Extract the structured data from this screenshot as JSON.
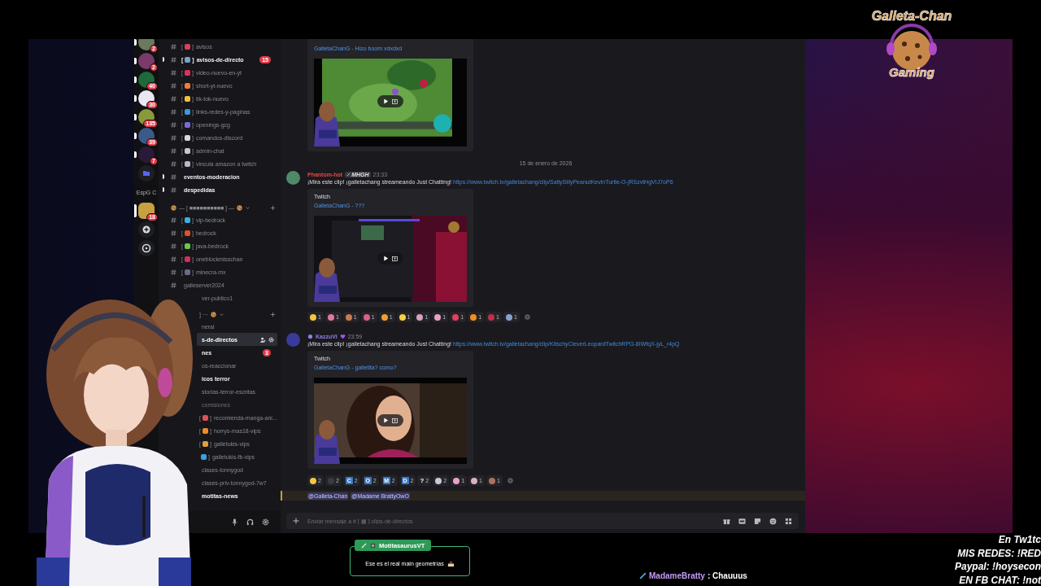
{
  "logo": {
    "title": "Galleta-Chan",
    "subtitle": "Gaming"
  },
  "servers": [
    {
      "kind": "server",
      "color": "#6b7a5a",
      "badge": "2",
      "unread": true,
      "selected": false
    },
    {
      "kind": "server",
      "color": "#7a3a6a",
      "badge": "2",
      "unread": true,
      "selected": false
    },
    {
      "kind": "server",
      "color": "#1f6a3a",
      "badge": "40",
      "unread": true,
      "selected": false
    },
    {
      "kind": "server",
      "color": "#e8e8f0",
      "badge": "30",
      "unread": true,
      "selected": false
    },
    {
      "kind": "server",
      "color": "#8a9a3a",
      "badge": "135",
      "unread": true,
      "selected": false
    },
    {
      "kind": "server",
      "color": "#3a5a8a",
      "badge": "39",
      "unread": true,
      "selected": false
    },
    {
      "kind": "server",
      "color": "#2a1a3a",
      "badge": "7",
      "unread": true,
      "selected": false
    },
    {
      "kind": "folder",
      "selected": false
    },
    {
      "kind": "label",
      "label": "EspG C",
      "selected": false
    },
    {
      "kind": "server",
      "color": "#c8a040",
      "badge": "18",
      "selected": true
    },
    {
      "kind": "add",
      "selected": false
    },
    {
      "kind": "discover",
      "selected": false
    }
  ],
  "channels": [
    {
      "kind": "channel",
      "open": "[",
      "color": "#d8405a",
      "close": "]",
      "name": "avisos",
      "unread": false,
      "selected": false,
      "muted": false
    },
    {
      "kind": "channel",
      "open": "[",
      "color": "#7aa0c8",
      "close": "]",
      "name": "avisos-de-directo",
      "unread": true,
      "selected": false,
      "muted": false,
      "badge": "15"
    },
    {
      "kind": "channel",
      "open": "[",
      "color": "#e0305a",
      "close": "]",
      "name": "video-nuevo-en-yt",
      "unread": false,
      "selected": false,
      "muted": false
    },
    {
      "kind": "channel",
      "open": "[",
      "color": "#f07a3a",
      "close": "]",
      "name": "short-yt-nuevo",
      "unread": false,
      "selected": false,
      "muted": false
    },
    {
      "kind": "channel",
      "open": "[",
      "color": "#f0c040",
      "close": "]",
      "name": "tik-tok-nuevo",
      "unread": false,
      "selected": false,
      "muted": false
    },
    {
      "kind": "channel",
      "open": "[",
      "color": "#3a9ad8",
      "close": "]",
      "name": "links-redes-y-paginas",
      "unread": false,
      "selected": false,
      "muted": false
    },
    {
      "kind": "channel",
      "open": "[",
      "color": "#7a6ad8",
      "close": "]",
      "name": "openings-gcg",
      "unread": false,
      "selected": false,
      "muted": false
    },
    {
      "kind": "channel",
      "open": "[",
      "color": "#d8d8e0",
      "close": "]",
      "name": "comandos-discord",
      "unread": false,
      "selected": false,
      "muted": false
    },
    {
      "kind": "channel",
      "open": "[",
      "color": "#c8c8d0",
      "close": "]",
      "name": "admin-chat",
      "unread": false,
      "selected": false,
      "muted": false
    },
    {
      "kind": "channel",
      "open": "[",
      "color": "#b8b8c8",
      "close": "]",
      "name": "vincula amazon a twitch",
      "unread": false,
      "selected": false,
      "muted": false
    },
    {
      "kind": "channel",
      "name": "eventos-moderacion",
      "unread": true,
      "selected": false,
      "muted": false
    },
    {
      "kind": "channel",
      "name": "despedidas",
      "unread": true,
      "selected": false,
      "muted": false
    },
    {
      "kind": "category",
      "name": "— [ ■■■■■■■■■■ ] —"
    },
    {
      "kind": "channel",
      "open": "[",
      "color": "#3ab0e0",
      "close": "]",
      "name": "vip-bedrock",
      "unread": false,
      "selected": false,
      "muted": false
    },
    {
      "kind": "channel",
      "open": "[",
      "color": "#e0502a",
      "close": "]",
      "name": "bedrock",
      "unread": false,
      "selected": false,
      "muted": false
    },
    {
      "kind": "channel",
      "open": "[",
      "color": "#6ac84a",
      "close": "]",
      "name": "java-bedrock",
      "unread": false,
      "selected": false,
      "muted": false
    },
    {
      "kind": "channel",
      "open": "[",
      "color": "#d0305a",
      "close": "]",
      "name": "oneblockmisschan",
      "unread": false,
      "selected": false,
      "muted": false
    },
    {
      "kind": "channel",
      "open": "[",
      "color": "#6a6a8a",
      "close": "]",
      "name": "minecra-mx",
      "unread": false,
      "selected": false,
      "muted": false
    },
    {
      "kind": "channel",
      "name": "galleserver2024",
      "unread": false,
      "selected": false,
      "muted": false
    },
    {
      "kind": "covered",
      "name": "ver-publico1",
      "unread": false,
      "selected": false,
      "muted": false
    },
    {
      "kind": "covered_category",
      "name": "] ···"
    },
    {
      "kind": "covered",
      "name": "neral",
      "unread": false,
      "selected": false,
      "muted": false
    },
    {
      "kind": "covered",
      "name": "s-de-directos",
      "unread": false,
      "selected": true,
      "muted": false
    },
    {
      "kind": "covered",
      "name": "nes",
      "unread": true,
      "selected": false,
      "muted": false,
      "badge": "3"
    },
    {
      "kind": "covered",
      "name": "os-reaccionar",
      "unread": false,
      "selected": false,
      "muted": false
    },
    {
      "kind": "covered",
      "name": "icos terror",
      "unread": true,
      "selected": false,
      "muted": false
    },
    {
      "kind": "covered",
      "name": "storias-terror-escritas",
      "unread": false,
      "selected": false,
      "muted": false
    },
    {
      "kind": "covered",
      "name": "comisiones",
      "unread": false,
      "selected": false,
      "muted": true
    },
    {
      "kind": "iconic",
      "open": "[",
      "color": "#e0505a",
      "close": "]",
      "name": "recomienda-manga-ani...",
      "unread": false,
      "selected": false,
      "muted": false
    },
    {
      "kind": "iconic",
      "open": "[",
      "color": "#f08a2a",
      "close": "]",
      "name": "horrys-mas18-vips",
      "unread": false,
      "selected": false,
      "muted": false
    },
    {
      "kind": "iconic",
      "open": "[",
      "color": "#e0a040",
      "close": "]",
      "name": "galletukis-vips",
      "unread": false,
      "selected": false,
      "muted": false
    },
    {
      "kind": "iconic",
      "color": "#3aa0e0",
      "close": "]",
      "name": "galletukis-fb-vips",
      "unread": false,
      "selected": false,
      "muted": false
    },
    {
      "kind": "covered",
      "name": "clases-tonnygod",
      "unread": false,
      "selected": false,
      "muted": false
    },
    {
      "kind": "covered",
      "name": "clases-priv-tonnygod-7w7",
      "unread": false,
      "selected": false,
      "muted": false
    },
    {
      "kind": "covered",
      "name": "motitas-news",
      "unread": true,
      "selected": false,
      "muted": false
    }
  ],
  "messages": [
    {
      "kind": "embed_only",
      "embed": {
        "title": "GalletaChanG - Hizo boom xdxdxd"
      }
    },
    {
      "kind": "date",
      "text": "15 de enero de 2026"
    },
    {
      "kind": "message",
      "author": "Phantom-hot",
      "color": "#e04848",
      "avatar": {
        "color": "#4f8a68"
      },
      "tag": "MHGH",
      "role_icon": false,
      "heart": false,
      "time": "23:33",
      "text": "¡Mira este clip! ¡galletachang streameando Just Chatting!",
      "link": "https://www.twitch.tv/galletachang/clip/SaltySillyPeanutKevinTurtle-O-jRSzvtHgVIJ7oP6",
      "embed": {
        "provider": "Twitch",
        "title": "GalletaChanG - ???"
      },
      "reactions": [
        {
          "kind": "emoji",
          "color": "#f5c542",
          "count": "1"
        },
        {
          "kind": "emoji",
          "color": "#e07a9a",
          "count": "1"
        },
        {
          "kind": "emoji",
          "color": "#c87a50",
          "count": "1"
        },
        {
          "kind": "emoji",
          "color": "#d9608a",
          "count": "1"
        },
        {
          "kind": "emoji",
          "color": "#f0a030",
          "count": "1"
        },
        {
          "kind": "emoji",
          "color": "#f5d042",
          "count": "1"
        },
        {
          "kind": "emoji",
          "color": "#d8a0c0",
          "count": "1"
        },
        {
          "kind": "emoji",
          "color": "#e8a0c8",
          "count": "1"
        },
        {
          "kind": "emoji",
          "color": "#e04060",
          "count": "1"
        },
        {
          "kind": "emoji",
          "color": "#f09020",
          "count": "1"
        },
        {
          "kind": "emoji",
          "color": "#c0304a",
          "count": "1"
        },
        {
          "kind": "emoji",
          "color": "#8aa0d0",
          "count": "1"
        }
      ]
    },
    {
      "kind": "message",
      "author": "KazzuVi",
      "color": "#8f7fe6",
      "avatar": {
        "color": "#3a3a9a"
      },
      "role_icon": true,
      "heart": true,
      "time": "23:59",
      "text": "¡Mira este clip! ¡galletachang streameando Just Chatting!",
      "link": "https://www.twitch.tv/galletachang/clip/KitschyCleverLeopardTwitchRPG-8IWfqX-jyL_r4pQ",
      "embed": {
        "provider": "Twitch",
        "title": "GalletaChanG - galletita? como?"
      },
      "reactions": [
        {
          "kind": "emoji",
          "color": "#f5c542",
          "count": "2"
        },
        {
          "kind": "emoji",
          "color": "#3a3a44",
          "count": "2"
        },
        {
          "kind": "letter",
          "glyph": "C",
          "count": "2"
        },
        {
          "kind": "letter",
          "glyph": "O",
          "count": "2"
        },
        {
          "kind": "letter",
          "glyph": "M",
          "count": "2"
        },
        {
          "kind": "letter",
          "glyph": "D",
          "count": "2"
        },
        {
          "kind": "symbol",
          "glyph": "?",
          "count": "2"
        },
        {
          "kind": "emoji",
          "color": "#c8c8d8",
          "count": "2"
        },
        {
          "kind": "emoji",
          "color": "#e8a0c8",
          "count": "1"
        },
        {
          "kind": "emoji",
          "color": "#d8b0c0",
          "count": "1"
        },
        {
          "kind": "emoji",
          "color": "#b07060",
          "count": "1"
        }
      ]
    }
  ],
  "mention_line": {
    "mentions": [
      "@Galleta-Chan",
      "@Madame BrattyOwO"
    ]
  },
  "composer": {
    "placeholder": "Enviar mensaje a # [ ▦ ] clips-de-directos"
  },
  "stream_chat_bubble": {
    "user": "MotitasaurusVT",
    "text": "Ese es el real main geometrías"
  },
  "stream_chat_line": {
    "user": "MadameBratty",
    "text": ": Chauuus"
  },
  "stream_info": [
    "En Tw1tc",
    "MIS REDES: !RED",
    "Paypal: !hoysecon",
    "EN FB CHAT: !not"
  ]
}
